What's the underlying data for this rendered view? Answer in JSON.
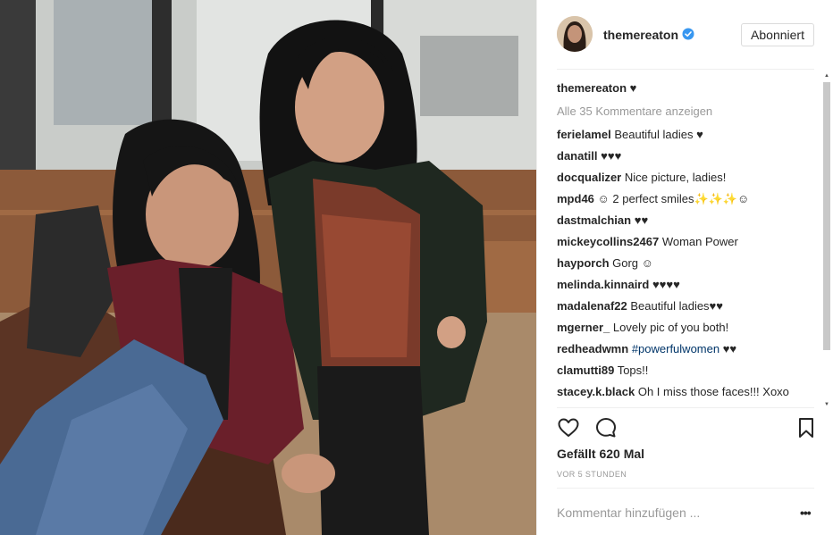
{
  "post": {
    "username": "themereaton",
    "verified": true,
    "follow_label": "Abonniert",
    "caption": {
      "user": "themereaton",
      "text": "♥︎"
    },
    "view_all": "Alle 35 Kommentare anzeigen",
    "comments": [
      {
        "user": "ferielamel",
        "text": "Beautiful ladies ♥︎"
      },
      {
        "user": "danatill",
        "text": "♥︎♥︎♥︎"
      },
      {
        "user": "docqualizer",
        "text": "Nice picture, ladies!"
      },
      {
        "user": "mpd46",
        "text": "☺ 2 perfect smiles✨✨✨☺"
      },
      {
        "user": "dastmalchian",
        "text": "♥♥"
      },
      {
        "user": "mickeycollins2467",
        "text": "Woman Power"
      },
      {
        "user": "hayporch",
        "text": "Gorg ☺"
      },
      {
        "user": "melinda.kinnaird",
        "text": "♥♥♥♥"
      },
      {
        "user": "madalenaf22",
        "text": "Beautiful ladies♥︎♥︎"
      },
      {
        "user": "mgerner_",
        "text": "Lovely pic of you both!"
      },
      {
        "user": "redheadwmn",
        "tag": "#powerfulwomen",
        "text": " ♥♥"
      },
      {
        "user": "clamutti89",
        "text": "Tops!!"
      },
      {
        "user": "stacey.k.black",
        "text": "Oh I miss those faces!!! Xoxo"
      }
    ],
    "likes": "Gefällt 620 Mal",
    "time": "VOR 5 STUNDEN",
    "comment_placeholder": "Kommentar hinzufügen ...",
    "more_label": "•••"
  },
  "icons": {
    "like": "heart-outline-icon",
    "comment": "speech-bubble-icon",
    "save": "bookmark-icon",
    "verified": "verified-badge-icon",
    "more": "more-options-icon"
  },
  "colors": {
    "verified_blue": "#3897f0",
    "hashtag": "#003569",
    "muted": "#999999",
    "divider": "#efefef"
  }
}
